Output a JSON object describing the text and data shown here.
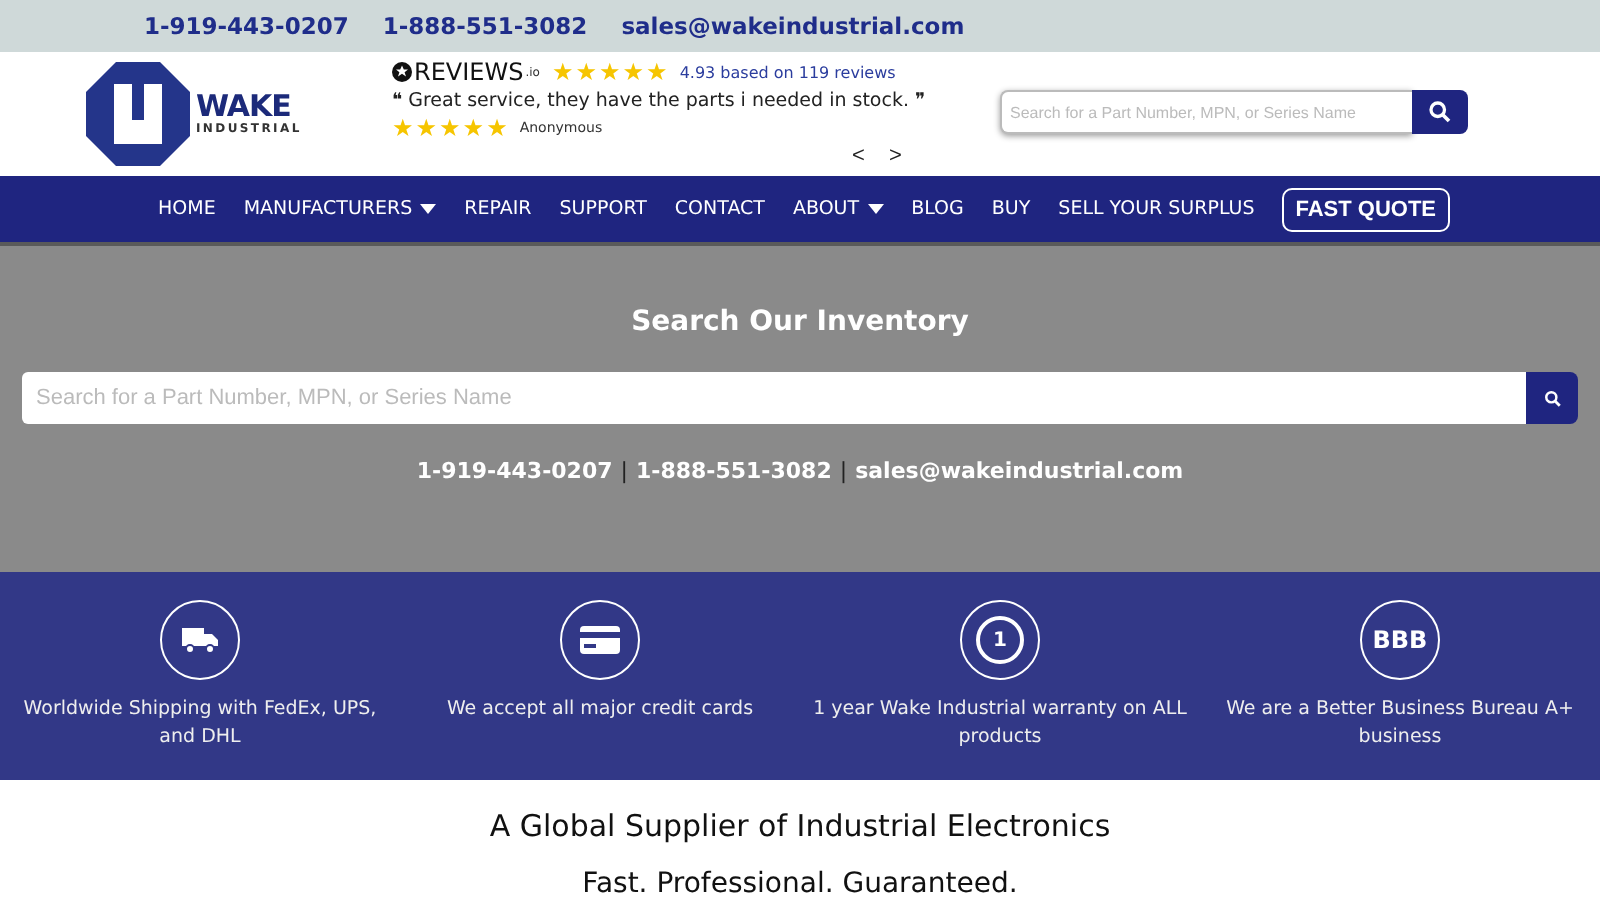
{
  "contact_bar": {
    "phones": [
      "1-919-443-0207",
      "1-888-551-3082"
    ],
    "email": "sales@wakeindustrial.com"
  },
  "logo": {
    "name": "WAKE",
    "subtitle": "INDUSTRIAL"
  },
  "reviews": {
    "brand": "REVIEWS",
    "brand_suffix": ".io",
    "stars": 5,
    "summary": "4.93 based on 119 reviews",
    "quote_open": "❝",
    "quote": "Great service, they have the parts i needed in stock.",
    "quote_close": "❞",
    "review": {
      "stars": 5,
      "author": "Anonymous"
    },
    "prev": "<",
    "next": ">"
  },
  "header_search": {
    "placeholder": "Search for a Part Number, MPN, or Series Name"
  },
  "nav": [
    {
      "label": "HOME",
      "dropdown": false
    },
    {
      "label": "MANUFACTURERS",
      "dropdown": true
    },
    {
      "label": "REPAIR",
      "dropdown": false
    },
    {
      "label": "SUPPORT",
      "dropdown": false
    },
    {
      "label": "CONTACT",
      "dropdown": false
    },
    {
      "label": "ABOUT",
      "dropdown": true
    },
    {
      "label": "BLOG",
      "dropdown": false
    },
    {
      "label": "BUY",
      "dropdown": false
    },
    {
      "label": "SELL YOUR SURPLUS",
      "dropdown": false
    }
  ],
  "fast_quote": "FAST QUOTE",
  "inventory": {
    "title": "Search Our Inventory",
    "placeholder": "Search for a Part Number, MPN, or Series Name",
    "phones": [
      "1-919-443-0207",
      "1-888-551-3082"
    ],
    "email": "sales@wakeindustrial.com",
    "separator": "|"
  },
  "features": [
    {
      "kind": "truck",
      "text": "Worldwide Shipping with FedEx, UPS, and DHL"
    },
    {
      "kind": "card",
      "text": "We accept all major credit cards"
    },
    {
      "kind": "award",
      "text": "1 year Wake Industrial warranty on ALL products",
      "badge": "1"
    },
    {
      "kind": "text",
      "text": "We are a Better Business Bureau A+ business",
      "badge": "BBB"
    }
  ],
  "tagline": {
    "title": "A Global Supplier of Industrial Electronics",
    "subtitle": "Fast. Professional. Guaranteed."
  }
}
